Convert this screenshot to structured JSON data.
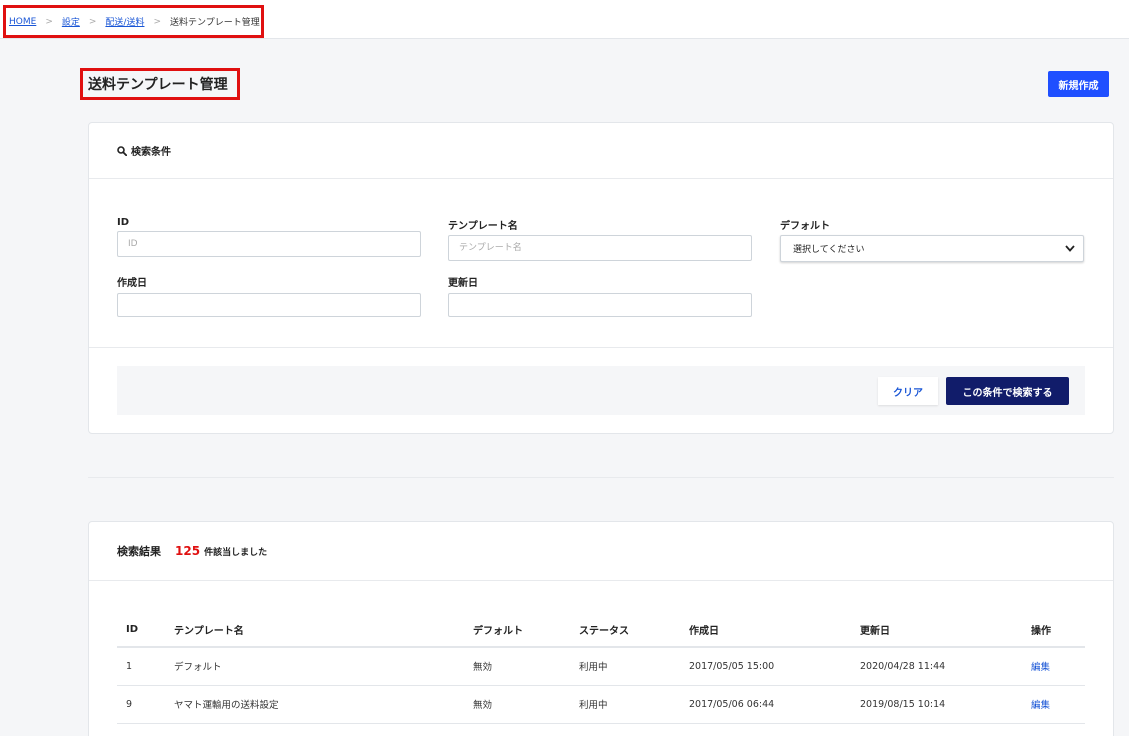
{
  "breadcrumb": {
    "home": "HOME",
    "settings": "設定",
    "shipping": "配送/送料",
    "current": "送料テンプレート管理",
    "separator": ">"
  },
  "page": {
    "title": "送料テンプレート管理",
    "new_button": "新規作成"
  },
  "search": {
    "header": "検索条件",
    "fields": {
      "id": {
        "label": "ID",
        "placeholder": "ID"
      },
      "template_name": {
        "label": "テンプレート名",
        "placeholder": "テンプレート名"
      },
      "default": {
        "label": "デフォルト",
        "selected": "選択してください"
      },
      "created": {
        "label": "作成日"
      },
      "updated": {
        "label": "更新日"
      }
    },
    "clear_button": "クリア",
    "submit_button": "この条件で検索する"
  },
  "results": {
    "label": "検索結果",
    "count": "125",
    "suffix": "件該当しました",
    "columns": [
      "ID",
      "テンプレート名",
      "デフォルト",
      "ステータス",
      "作成日",
      "更新日",
      "操作"
    ],
    "rows": [
      [
        "1",
        "デフォルト",
        "無効",
        "利用中",
        "2017/05/05 15:00",
        "2020/04/28 11:44",
        "編集"
      ],
      [
        "9",
        "ヤマト運輸用の送料設定",
        "無効",
        "利用中",
        "2017/05/06 06:44",
        "2019/08/15 10:14",
        "編集"
      ]
    ]
  },
  "colors": {
    "primary": "#1f4fff",
    "dark_button": "#111c6a",
    "highlight": "#e01010",
    "link": "#1a56d6"
  }
}
